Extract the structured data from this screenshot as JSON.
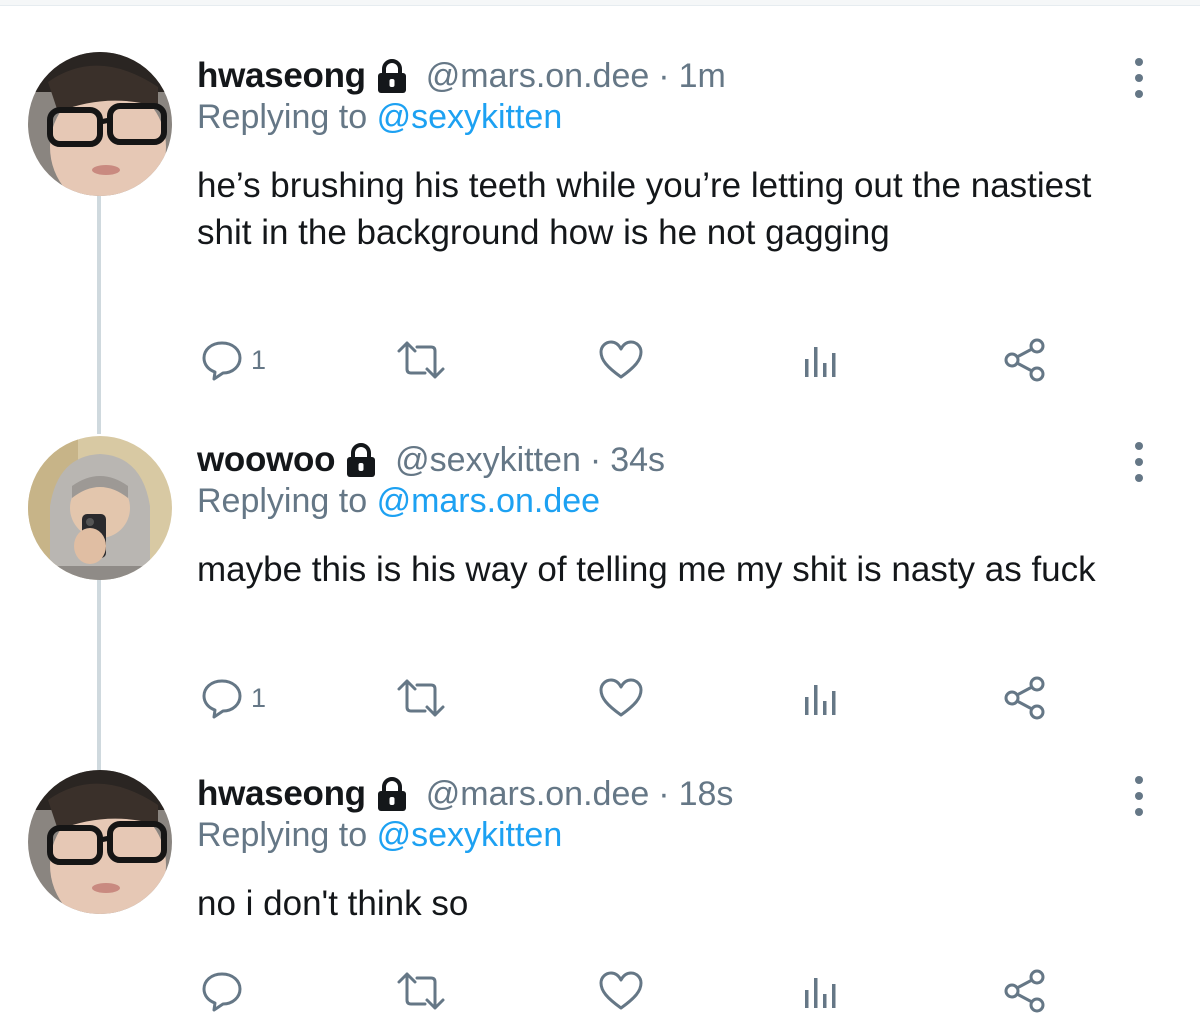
{
  "colors": {
    "text": "#14171a",
    "secondary": "#657786",
    "link": "#1da1f2",
    "thread_line": "#cfd9de"
  },
  "icons": {
    "lock": "lock-icon",
    "more": "more-vertical-icon",
    "reply": "reply-icon",
    "retweet": "retweet-icon",
    "like": "heart-icon",
    "analytics": "analytics-icon",
    "share": "share-icon"
  },
  "tweets": [
    {
      "display_name": "hwaseong",
      "handle": "@mars.on.dee",
      "separator": "·",
      "time": "1m",
      "replying_prefix": "Replying to",
      "replying_to": "@sexykitten",
      "text": "he’s brushing his teeth while you’re letting out the nastiest shit in the background how is he not gagging",
      "reply_count": "1"
    },
    {
      "display_name": "woowoo",
      "handle": "@sexykitten",
      "separator": "·",
      "time": "34s",
      "replying_prefix": "Replying to",
      "replying_to": "@mars.on.dee",
      "text": "maybe this is his way of telling me my shit is nasty as fuck",
      "reply_count": "1"
    },
    {
      "display_name": "hwaseong",
      "handle": "@mars.on.dee",
      "separator": "·",
      "time": "18s",
      "replying_prefix": "Replying to",
      "replying_to": "@sexykitten",
      "text": "no i don't think so",
      "reply_count": ""
    }
  ]
}
